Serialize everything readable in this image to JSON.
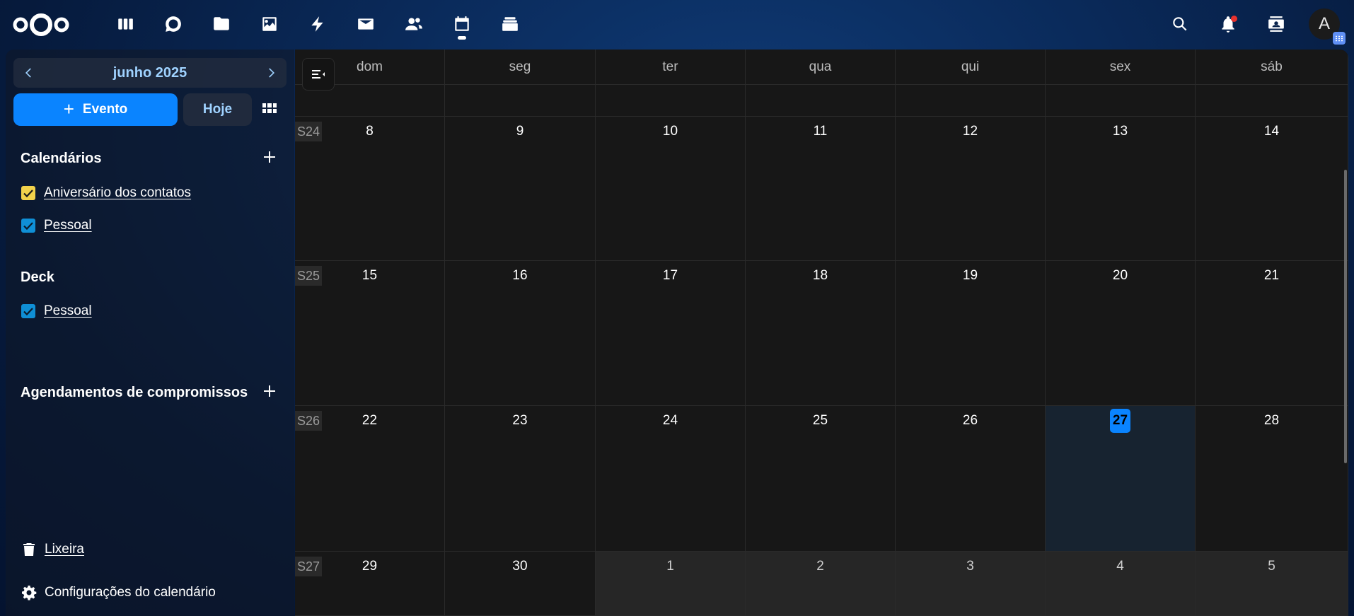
{
  "header": {
    "logo": "nextcloud-logo",
    "apps": [
      {
        "name": "dashboard",
        "icon": "dashboard-icon"
      },
      {
        "name": "talk",
        "icon": "talk-icon"
      },
      {
        "name": "files",
        "icon": "folder-icon"
      },
      {
        "name": "photos",
        "icon": "image-icon"
      },
      {
        "name": "activity",
        "icon": "lightning-icon"
      },
      {
        "name": "mail",
        "icon": "mail-icon"
      },
      {
        "name": "contacts",
        "icon": "contacts-icon"
      },
      {
        "name": "calendar",
        "icon": "calendar-icon",
        "active": true
      },
      {
        "name": "deck",
        "icon": "deck-icon"
      }
    ],
    "avatar_letter": "A"
  },
  "sidebar": {
    "month": "junho 2025",
    "new_event": "Evento",
    "today": "Hoje",
    "calendars_title": "Calendários",
    "calendars": [
      {
        "label": "Aniversário dos contatos",
        "color": "#f2d24b"
      },
      {
        "label": "Pessoal",
        "color": "#0f8fd6"
      }
    ],
    "deck_title": "Deck",
    "deck_calendars": [
      {
        "label": "Pessoal",
        "color": "#0f8fd6"
      }
    ],
    "appointments_title": "Agendamentos de compromissos",
    "trash": "Lixeira",
    "settings": "Configurações do calendário"
  },
  "calendar": {
    "weekdays": [
      "dom",
      "seg",
      "ter",
      "qua",
      "qui",
      "sex",
      "sáb"
    ],
    "weeks": [
      {
        "label": "S24",
        "days": [
          "8",
          "9",
          "10",
          "11",
          "12",
          "13",
          "14"
        ]
      },
      {
        "label": "S25",
        "days": [
          "15",
          "16",
          "17",
          "18",
          "19",
          "20",
          "21"
        ]
      },
      {
        "label": "S26",
        "days": [
          "22",
          "23",
          "24",
          "25",
          "26",
          "27",
          "28"
        ]
      },
      {
        "label": "S27",
        "days": [
          "29",
          "30",
          "1",
          "2",
          "3",
          "4",
          "5"
        ]
      }
    ],
    "today": "27",
    "accent": "#0a84ff"
  }
}
